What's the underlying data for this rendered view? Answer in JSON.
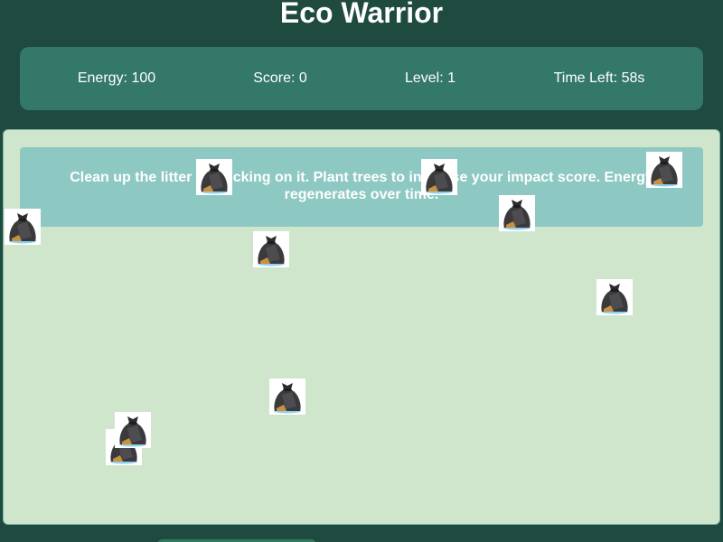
{
  "header": {
    "title": "Eco Warrior"
  },
  "stats": {
    "energy": "Energy: 100",
    "score": "Score: 0",
    "level": "Level: 1",
    "time_left": "Time Left: 58s"
  },
  "instructions": {
    "text": "Clean up the litter by clicking on it. Plant trees to increase your impact score. Energy regenerates over time."
  },
  "litter": {
    "icon": "trash-bag-icon",
    "count": 11
  },
  "colors": {
    "background": "#1e4a40",
    "stats_bar": "#34786a",
    "game_area": "#d0e6cc",
    "instructions_panel": "#8ec8c2",
    "text": "#ffffff"
  }
}
